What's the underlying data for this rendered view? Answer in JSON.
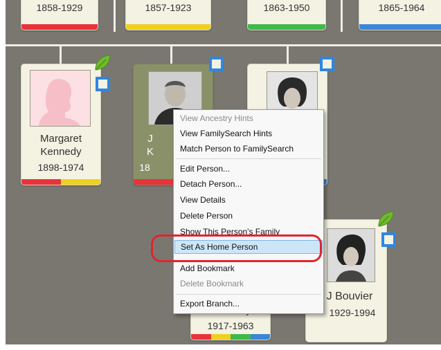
{
  "top_row": [
    {
      "dates": "1858-1929",
      "colors": [
        "#e8333a"
      ]
    },
    {
      "dates": "1857-1923",
      "colors": [
        "#f0d01e"
      ]
    },
    {
      "dates": "1863-1950",
      "colors": [
        "#3fb94a"
      ]
    },
    {
      "dates": "1865-1964",
      "colors": [
        "#3d86d6"
      ]
    }
  ],
  "people": {
    "margaret": {
      "first": "Margaret",
      "last": "Kennedy",
      "dates": "1898-1974",
      "colors": [
        "#e8333a",
        "#f0d01e"
      ]
    },
    "selected": {
      "first": "J",
      "last": "K",
      "dates": "18"
    },
    "bottom_center": {
      "last": "Kennedy",
      "dates": "1917-1963",
      "colors": [
        "#e8333a",
        "#f0d01e",
        "#3fb94a",
        "#3d86d6"
      ]
    },
    "bouvier": {
      "name": "J Bouvier",
      "dates": "1929-1994"
    }
  },
  "context_menu": {
    "items": [
      {
        "label": "View Ancestry Hints",
        "disabled": true
      },
      {
        "label": "View FamilySearch Hints",
        "disabled": false
      },
      {
        "label": "Match Person to FamilySearch",
        "disabled": false
      },
      {
        "label": "Edit Person...",
        "disabled": false
      },
      {
        "label": "Detach Person...",
        "disabled": false
      },
      {
        "label": "View Details",
        "disabled": false
      },
      {
        "label": "Delete Person",
        "disabled": false
      },
      {
        "label": "Show This Person's Family",
        "disabled": false
      },
      {
        "label": "Set As Home Person",
        "disabled": false,
        "highlighted": true
      },
      {
        "label": "Add Bookmark",
        "disabled": false
      },
      {
        "label": "Delete Bookmark",
        "disabled": true
      },
      {
        "label": "Export Branch...",
        "disabled": false
      }
    ]
  },
  "colors": {
    "red": "#e8333a",
    "yellow": "#f0d01e",
    "green": "#3fb94a",
    "blue": "#3d86d6",
    "annotation": "#e0252e",
    "highlight": "#cde6f7"
  },
  "icons": [
    "leaf-icon",
    "hint-square-icon",
    "silhouette-icon"
  ]
}
